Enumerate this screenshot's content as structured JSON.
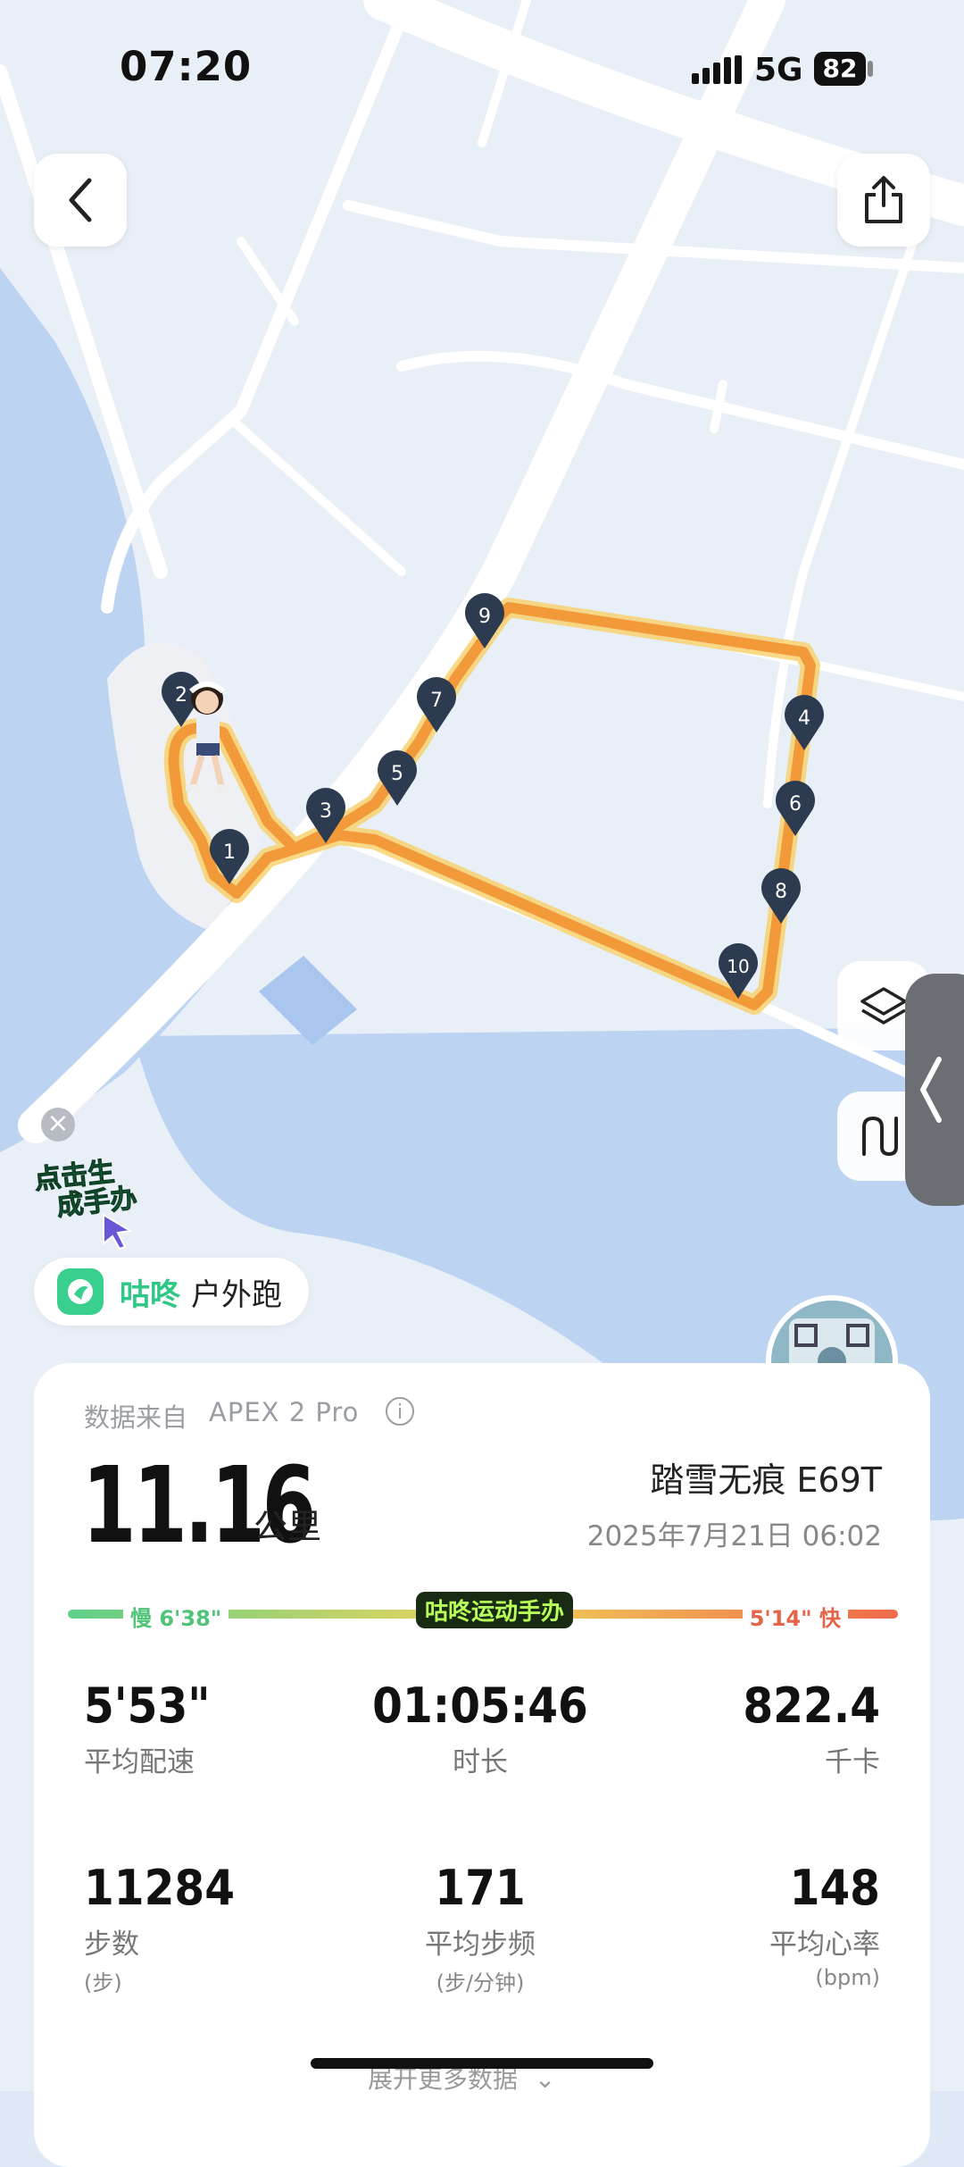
{
  "status": {
    "time": "07:20",
    "network": "5G",
    "battery": "82"
  },
  "nav": {
    "back_icon": "back-arrow-icon",
    "share_icon": "share-icon"
  },
  "map": {
    "markers": [
      "1",
      "2",
      "3",
      "4",
      "5",
      "6",
      "7",
      "8",
      "9",
      "10"
    ],
    "layers_icon": "layers-icon",
    "route_icon": "route-icon",
    "route_color": "#f29a3a"
  },
  "promo": {
    "line1": "点击生",
    "line2": "成手办"
  },
  "activity": {
    "brand": "咕咚",
    "type": "户外跑"
  },
  "summary": {
    "source_label": "数据来自",
    "device": "APEX 2 Pro",
    "distance": "11.16",
    "distance_unit": "公里",
    "shoe": "踏雪无痕 E69T",
    "date": "2025年7月21日 06:02",
    "slow_label": "慢 6'38\"",
    "fast_label": "5'14\" 快",
    "badge": "咕咚运动手办",
    "pace_slow_color": "#5fd08a",
    "pace_fast_color": "#f06a4a"
  },
  "stats": [
    {
      "value": "5'53\"",
      "label": "平均配速",
      "sub": ""
    },
    {
      "value": "01:05:46",
      "label": "时长",
      "sub": ""
    },
    {
      "value": "822.4",
      "label": "千卡",
      "sub": ""
    },
    {
      "value": "11284",
      "label": "步数",
      "sub": "(步)"
    },
    {
      "value": "171",
      "label": "平均步频",
      "sub": "(步/分钟)"
    },
    {
      "value": "148",
      "label": "平均心率",
      "sub": "(bpm)"
    }
  ],
  "footer": {
    "more": "展开更多数据"
  }
}
